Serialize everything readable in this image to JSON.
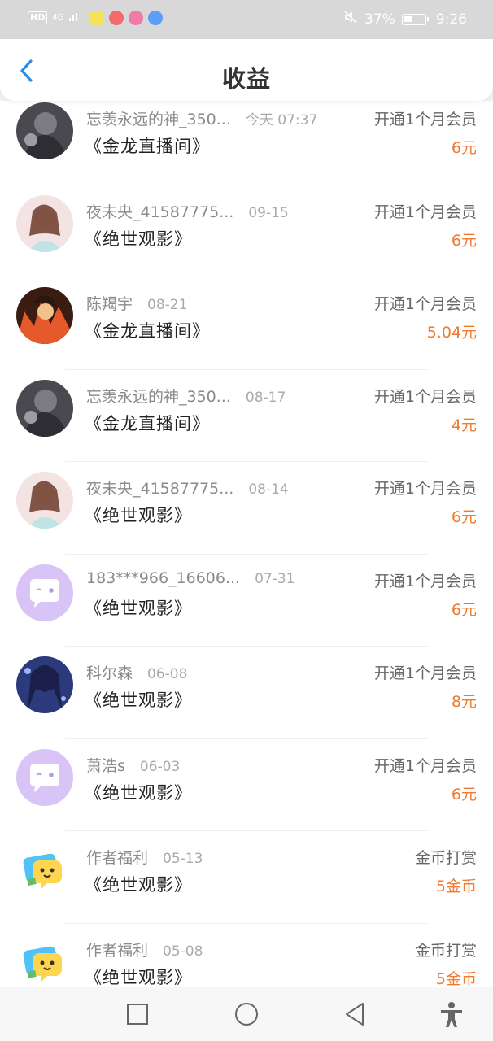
{
  "status_bar": {
    "hd": "HD",
    "net": "4G",
    "battery_pct": "37%",
    "time": "9:26"
  },
  "header": {
    "title": "收益",
    "back_icon": "chevron-left-icon"
  },
  "records": [
    {
      "name": "忘羡永远的神_350...",
      "date": "今天 07:37",
      "book": "《金龙直播间》",
      "type": "开通1个月会员",
      "amount": "6元",
      "avatar": "dark-portrait"
    },
    {
      "name": "夜未央_41587775...",
      "date": "09-15",
      "book": "《绝世观影》",
      "type": "开通1个月会员",
      "amount": "6元",
      "avatar": "pink-portrait"
    },
    {
      "name": "陈羯宇",
      "date": "08-21",
      "book": "《金龙直播间》",
      "type": "开通1个月会员",
      "amount": "5.04元",
      "avatar": "fire-portrait"
    },
    {
      "name": "忘羡永远的神_350...",
      "date": "08-17",
      "book": "《金龙直播间》",
      "type": "开通1个月会员",
      "amount": "4元",
      "avatar": "dark-portrait"
    },
    {
      "name": "夜未央_41587775...",
      "date": "08-14",
      "book": "《绝世观影》",
      "type": "开通1个月会员",
      "amount": "6元",
      "avatar": "pink-portrait"
    },
    {
      "name": "183***966_16606...",
      "date": "07-31",
      "book": "《绝世观影》",
      "type": "开通1个月会员",
      "amount": "6元",
      "avatar": "default-chat"
    },
    {
      "name": "科尔森",
      "date": "06-08",
      "book": "《绝世观影》",
      "type": "开通1个月会员",
      "amount": "8元",
      "avatar": "blue-portrait"
    },
    {
      "name": "萧浩s",
      "date": "06-03",
      "book": "《绝世观影》",
      "type": "开通1个月会员",
      "amount": "6元",
      "avatar": "default-chat"
    },
    {
      "name": "作者福利",
      "date": "05-13",
      "book": "《绝世观影》",
      "type": "金币打赏",
      "amount": "5金币",
      "avatar": "author-chat"
    },
    {
      "name": "作者福利",
      "date": "05-08",
      "book": "《绝世观影》",
      "type": "金币打赏",
      "amount": "5金币",
      "avatar": "author-chat"
    }
  ],
  "colors": {
    "accent_blue": "#2a8de8",
    "amount_orange": "#f07a2f",
    "default_avatar_bg": "#d9c4f7"
  },
  "nav_bar": {
    "items": [
      "square-icon",
      "circle-home-icon",
      "triangle-back-icon",
      "accessibility-icon"
    ]
  }
}
